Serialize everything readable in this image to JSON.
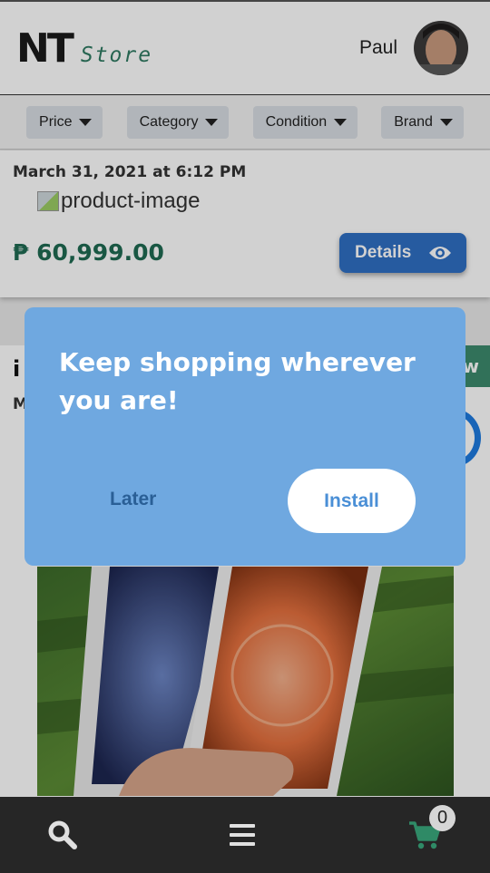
{
  "header": {
    "logo_nt": "NT",
    "logo_store": "Store",
    "user_name": "Paul"
  },
  "filters": [
    {
      "label": "Price"
    },
    {
      "label": "Category"
    },
    {
      "label": "Condition"
    },
    {
      "label": "Brand"
    }
  ],
  "product_card_1": {
    "date": "March 31, 2021 at 6:12 PM",
    "image_alt": "product-image",
    "price": "₱ 60,999.00",
    "details_label": "Details"
  },
  "product_card_2": {
    "title_partial": "i",
    "subtitle_partial": "M",
    "badge_partial": "w"
  },
  "dialog": {
    "title": "Keep shopping wherever you are!",
    "later_label": "Later",
    "install_label": "Install"
  },
  "bottom_nav": {
    "cart_count": "0",
    "icons": [
      "search-icon",
      "menu-icon",
      "cart-icon"
    ]
  },
  "colors": {
    "brand_green": "#2f7a62",
    "details_blue": "#2f6fc4",
    "dialog_blue": "#6fa8e0",
    "nav_dark": "#262626"
  }
}
